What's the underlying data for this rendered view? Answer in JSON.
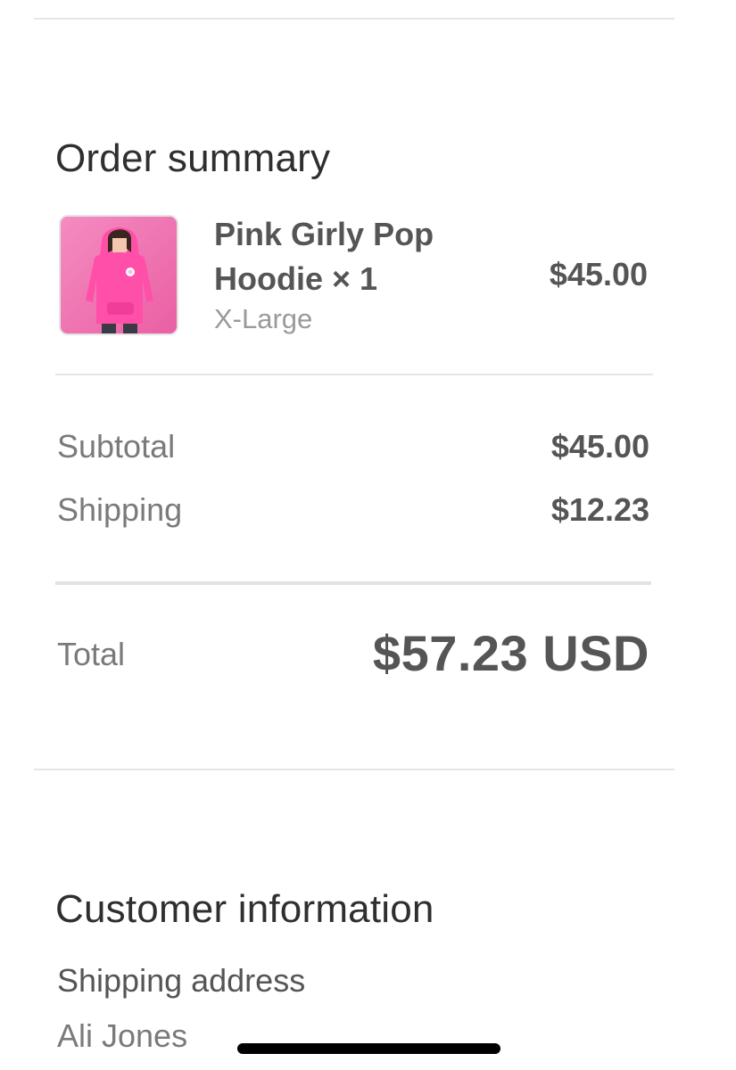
{
  "order_summary": {
    "title": "Order summary",
    "item": {
      "name": "Pink Girly Pop Hoodie × 1",
      "variant": "X-Large",
      "price": "$45.00",
      "image_icon": "pink-hoodie-product-photo"
    },
    "subtotal": {
      "label": "Subtotal",
      "value": "$45.00"
    },
    "shipping": {
      "label": "Shipping",
      "value": "$12.23"
    },
    "total": {
      "label": "Total",
      "value": "$57.23 USD"
    }
  },
  "customer_information": {
    "title": "Customer information",
    "shipping_address": {
      "label": "Shipping address",
      "name": "Ali Jones"
    }
  },
  "colors": {
    "hoodie_pink": "#f06fae",
    "text_dark": "#555555",
    "text_muted": "#7a7a7a"
  }
}
